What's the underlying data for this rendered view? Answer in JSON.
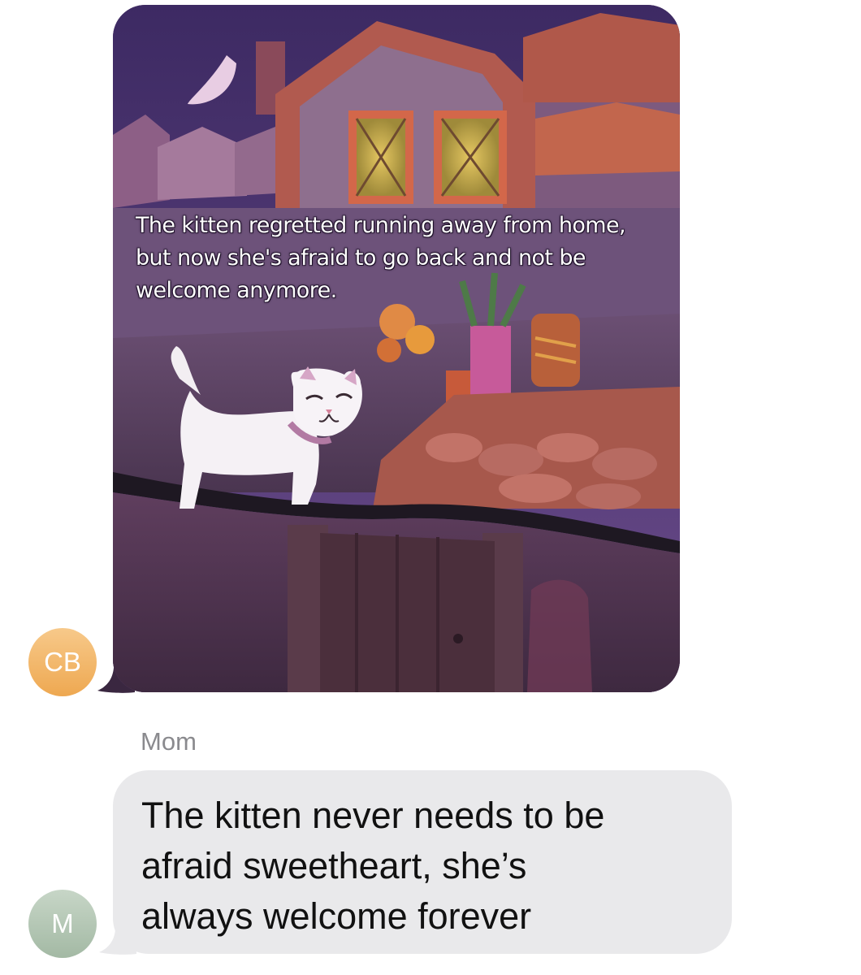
{
  "conversation": {
    "incoming_image_message": {
      "sender_initials": "CB",
      "caption_lines": [
        "The kitten regretted running away from home,",
        "but now she's afraid to go back and not be",
        "welcome anymore."
      ]
    },
    "incoming_text_message": {
      "sender_name": "Mom",
      "sender_initials": "M",
      "lines": [
        "The kitten never needs to be",
        "afraid sweetheart, she’s",
        "always welcome forever"
      ]
    }
  },
  "colors": {
    "cb_avatar": "#eea851",
    "m_avatar": "#a3b9a4",
    "bubble_gray": "#e9e9eb",
    "sender_name_gray": "#8a8a8e"
  }
}
